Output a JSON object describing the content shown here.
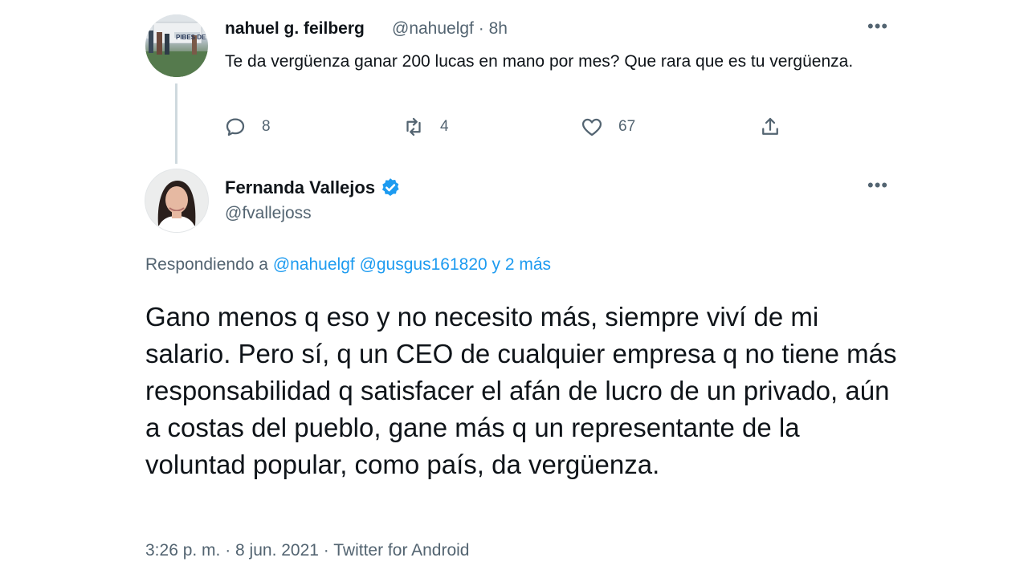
{
  "reply_tweet": {
    "author_name": "nahuel g. feilberg",
    "handle": "@nahuelgf",
    "time": "8h",
    "text": "Te da vergüenza ganar 200 lucas en mano por mes? Que rara que es tu vergüenza.",
    "actions": {
      "reply_count": "8",
      "retweet_count": "4",
      "like_count": "67"
    },
    "more_label": "•••",
    "avatar_banner_text": "PIBES DE"
  },
  "main_tweet": {
    "author_name": "Fernanda Vallejos",
    "handle": "@fvallejoss",
    "more_label": "•••",
    "replying_prefix": "Respondiendo a",
    "replying_mention_1": "@nahuelgf",
    "replying_mention_2": "@gusgus161820",
    "replying_more": "y 2 más",
    "text": "Gano menos q eso y no necesito más, siempre viví de mi salario. Pero sí, q un CEO de cualquier empresa q no tiene más responsabilidad q satisfacer el afán de lucro de un privado, aún a costas del pueblo, gane más q un representante de la voluntad popular, como país, da vergüenza.",
    "timestamp": "3:26 p. m. · 8 jun. 2021 · Twitter for Android"
  },
  "colors": {
    "link": "#1d9bf0",
    "secondary_text": "#536471",
    "verified_badge": "#1d9bf0"
  },
  "icons": {
    "reply": "speech-bubble",
    "retweet": "retweet-arrows",
    "like": "heart",
    "share": "share-arrow-up",
    "verified": "verified-badge",
    "more": "more-dots"
  }
}
